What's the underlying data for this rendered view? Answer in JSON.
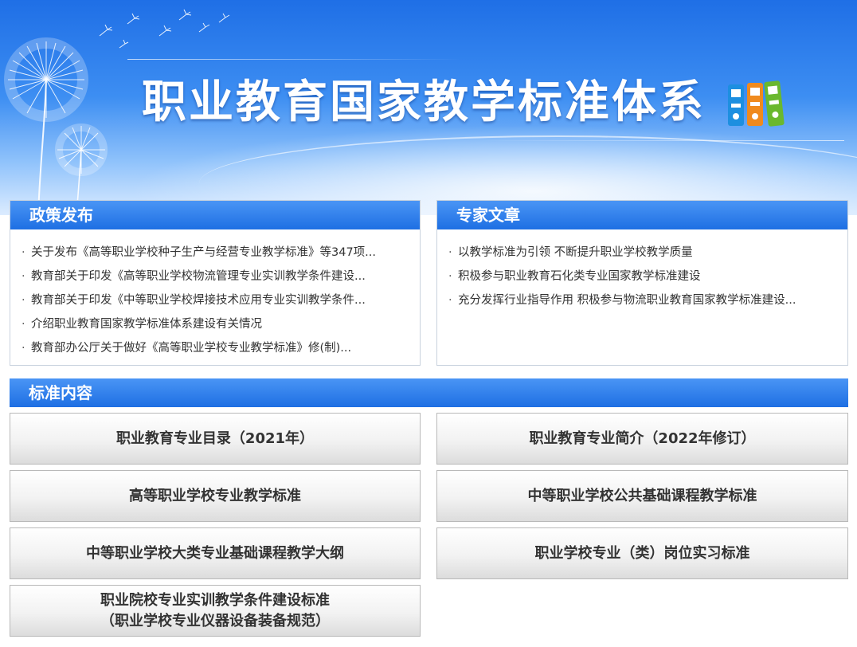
{
  "banner": {
    "title": "职业教育国家教学标准体系"
  },
  "policy": {
    "title": "政策发布",
    "items": [
      "关于发布《高等职业学校种子生产与经营专业教学标准》等347项...",
      "教育部关于印发《高等职业学校物流管理专业实训教学条件建设...",
      "教育部关于印发《中等职业学校焊接技术应用专业实训教学条件...",
      "介绍职业教育国家教学标准体系建设有关情况",
      "教育部办公厅关于做好《高等职业学校专业教学标准》修(制)..."
    ]
  },
  "expert": {
    "title": "专家文章",
    "items": [
      "以教学标准为引领 不断提升职业学校教学质量",
      "积极参与职业教育石化类专业国家教学标准建设",
      "充分发挥行业指导作用 积极参与物流职业教育国家教学标准建设..."
    ]
  },
  "standards": {
    "title": "标准内容",
    "buttons": [
      "职业教育专业目录（2021年）",
      "职业教育专业简介（2022年修订）",
      "高等职业学校专业教学标准",
      "中等职业学校公共基础课程教学标准",
      "中等职业学校大类专业基础课程教学大纲",
      "职业学校专业（类）岗位实习标准",
      "职业院校专业实训教学条件建设标准\n（职业学校专业仪器设备装备规范）"
    ]
  },
  "colors": {
    "header_blue": "#1e6fe3",
    "banner_blue": "#3d8ef2",
    "text": "#333333"
  }
}
